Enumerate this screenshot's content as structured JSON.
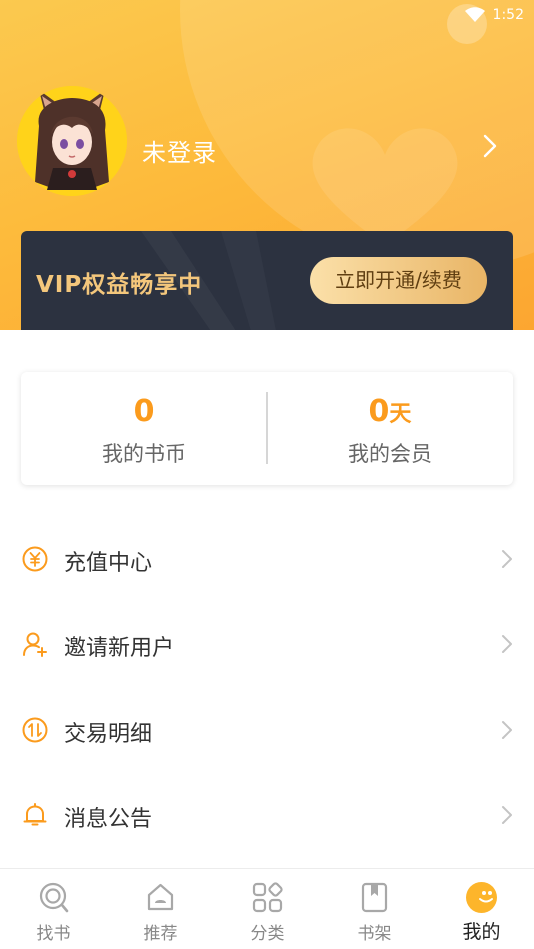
{
  "status_bar": {
    "time": "1:52",
    "icons": [
      "wifi-icon"
    ]
  },
  "profile": {
    "login_status": "未登录",
    "avatar": "anime-girl-avatar"
  },
  "vip": {
    "title": "VIP权益畅享中",
    "button_label": "立即开通/续费"
  },
  "stats": [
    {
      "value": "0",
      "unit": "",
      "label": "我的书币"
    },
    {
      "value": "0",
      "unit": "天",
      "label": "我的会员"
    }
  ],
  "menu": [
    {
      "label": "充值中心",
      "icon": "yuan-coin-icon"
    },
    {
      "label": "邀请新用户",
      "icon": "add-user-icon"
    },
    {
      "label": "交易明细",
      "icon": "transaction-icon"
    },
    {
      "label": "消息公告",
      "icon": "bell-icon"
    }
  ],
  "tabs": [
    {
      "label": "找书",
      "icon": "search-book-icon",
      "active": false
    },
    {
      "label": "推荐",
      "icon": "recommend-icon",
      "active": false
    },
    {
      "label": "分类",
      "icon": "category-icon",
      "active": false
    },
    {
      "label": "书架",
      "icon": "bookshelf-icon",
      "active": false
    },
    {
      "label": "我的",
      "icon": "smiley-icon",
      "active": true
    }
  ],
  "colors": {
    "header_yellow": "#fdbb3c",
    "accent_orange": "#fb9b1d",
    "vip_card_bg": "#2c3240",
    "vip_gold": "#f4c77c"
  }
}
